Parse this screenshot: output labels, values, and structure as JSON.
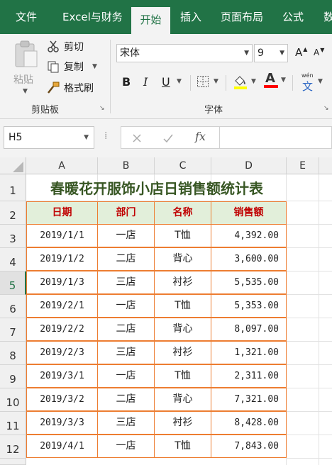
{
  "ribbon_tabs": [
    {
      "label": "文件"
    },
    {
      "label": "Excel与财务"
    },
    {
      "label": "开始"
    },
    {
      "label": "插入"
    },
    {
      "label": "页面布局"
    },
    {
      "label": "公式"
    },
    {
      "label": "数"
    }
  ],
  "clipboard": {
    "paste_label": "粘贴",
    "cut_label": "剪切",
    "copy_label": "复制",
    "format_painter_label": "格式刷",
    "group_label": "剪贴板"
  },
  "font": {
    "font_name": "宋体",
    "font_size": "9",
    "bold_label": "B",
    "italic_label": "I",
    "underline_label": "U",
    "grow_label": "A",
    "shrink_label": "A",
    "font_color_label": "A",
    "phonetic_label": "文",
    "phonetic_top": "wén",
    "group_label": "字体",
    "fill_color": "#ffff00",
    "font_color": "#ff0000"
  },
  "formula_bar": {
    "name_box": "H5",
    "fx_label": "fx",
    "formula": ""
  },
  "columns": [
    "A",
    "B",
    "C",
    "D",
    "E"
  ],
  "rows": [
    "1",
    "2",
    "3",
    "4",
    "5",
    "6",
    "7",
    "8",
    "9",
    "10",
    "11",
    "12"
  ],
  "selected_row": "5",
  "sheet": {
    "title": "春暖花开服饰小店日销售额统计表",
    "headers": [
      "日期",
      "部门",
      "名称",
      "销售额"
    ],
    "data": [
      [
        "2019/1/1",
        "一店",
        "T恤",
        "4,392.00"
      ],
      [
        "2019/1/2",
        "二店",
        "背心",
        "3,600.00"
      ],
      [
        "2019/1/3",
        "三店",
        "衬衫",
        "5,535.00"
      ],
      [
        "2019/2/1",
        "一店",
        "T恤",
        "5,353.00"
      ],
      [
        "2019/2/2",
        "二店",
        "背心",
        "8,097.00"
      ],
      [
        "2019/2/3",
        "三店",
        "衬衫",
        "1,321.00"
      ],
      [
        "2019/3/1",
        "一店",
        "T恤",
        "2,311.00"
      ],
      [
        "2019/3/2",
        "二店",
        "背心",
        "7,321.00"
      ],
      [
        "2019/3/3",
        "三店",
        "衬衫",
        "8,428.00"
      ],
      [
        "2019/4/1",
        "一店",
        "T恤",
        "7,843.00"
      ]
    ]
  },
  "colors": {
    "brand": "#217346",
    "title_text": "#375623",
    "header_fill": "#e2efda",
    "header_text": "#c00000",
    "cell_border": "#ed7d31"
  }
}
